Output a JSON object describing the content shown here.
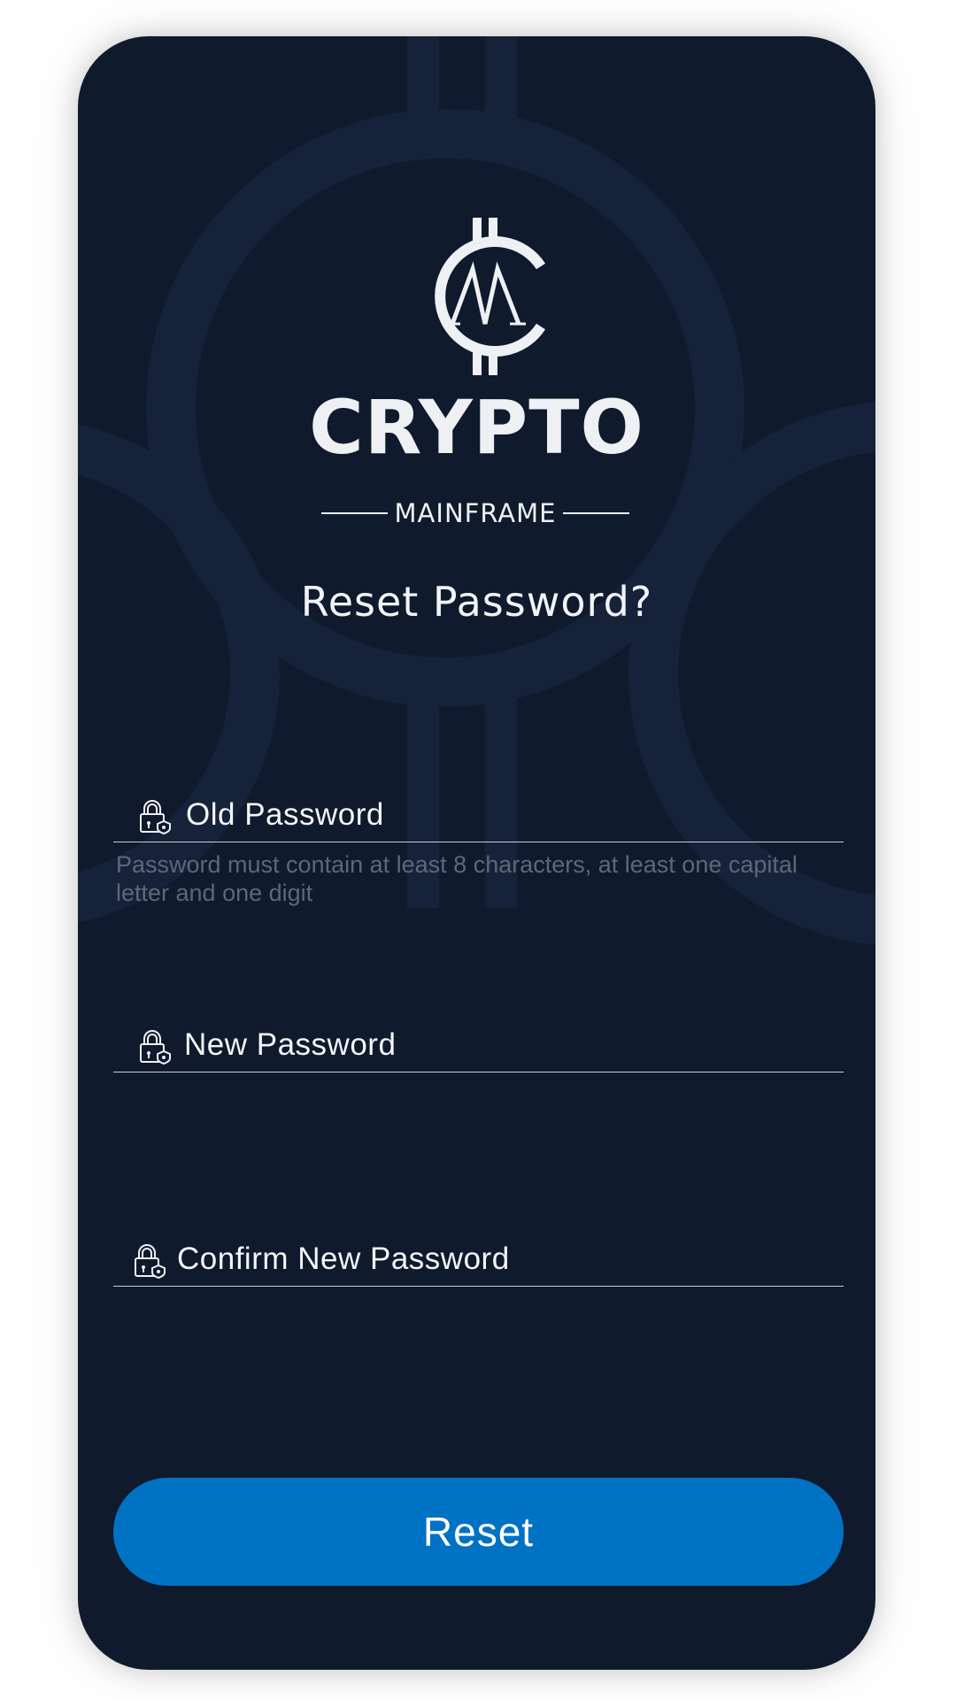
{
  "brand": {
    "name": "CRYPTO",
    "subname": "MAINFRAME",
    "monogram": "M"
  },
  "title": "Reset Password?",
  "fields": {
    "old_password": {
      "label": "Old Password",
      "icon": "lock-shield-icon"
    },
    "new_password": {
      "label": "New Password",
      "icon": "lock-shield-icon"
    },
    "confirm_password": {
      "label": "Confirm New Password",
      "icon": "lock-shield-icon"
    }
  },
  "hint": "Password must contain at least 8 characters, at least one capital letter and one digit",
  "actions": {
    "reset_label": "Reset"
  },
  "colors": {
    "background": "#0f1a2d",
    "accent": "#0072c4",
    "text": "#f4f5f7",
    "hint": "#5f6776"
  }
}
